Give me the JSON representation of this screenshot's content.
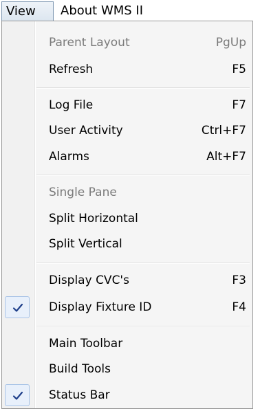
{
  "menubar": {
    "view_label": "View",
    "about_label": "About WMS II"
  },
  "menu": {
    "parent_layout": {
      "label": "Parent Layout",
      "shortcut": "PgUp"
    },
    "refresh": {
      "label": "Refresh",
      "shortcut": "F5"
    },
    "log_file": {
      "label": "Log File",
      "shortcut": "F7"
    },
    "user_activity": {
      "label": "User Activity",
      "shortcut": "Ctrl+F7"
    },
    "alarms": {
      "label": "Alarms",
      "shortcut": "Alt+F7"
    },
    "single_pane": {
      "label": "Single Pane"
    },
    "split_horizontal": {
      "label": "Split Horizontal"
    },
    "split_vertical": {
      "label": "Split Vertical"
    },
    "display_cvcs": {
      "label": "Display CVC's",
      "shortcut": "F3"
    },
    "display_fixture_id": {
      "label": "Display Fixture ID",
      "shortcut": "F4",
      "checked": true
    },
    "main_toolbar": {
      "label": "Main Toolbar"
    },
    "build_tools": {
      "label": "Build Tools"
    },
    "status_bar": {
      "label": "Status Bar",
      "checked": true
    }
  },
  "colors": {
    "check_mark": "#1e3f8a",
    "disabled_text": "#7a7a7a"
  },
  "icons": {
    "check": "checkmark-icon"
  }
}
